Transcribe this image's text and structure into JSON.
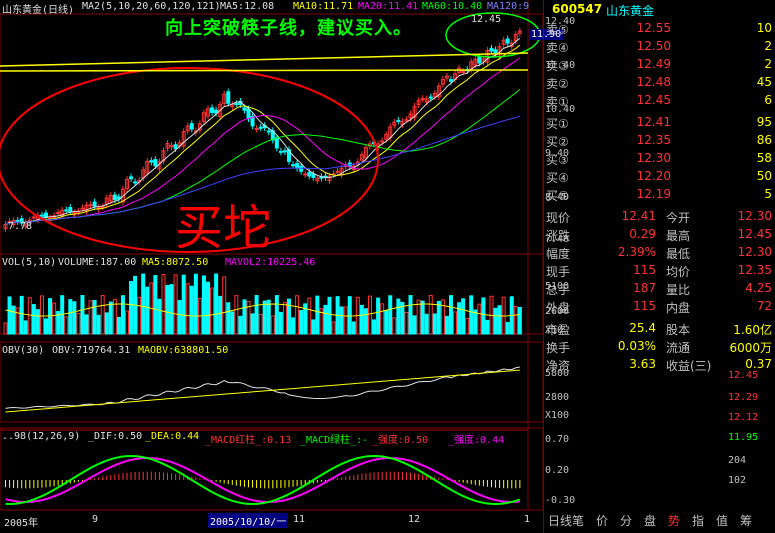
{
  "stock": {
    "name": "山东黄金",
    "code": "600547"
  },
  "main": {
    "title": "山东黄金(日线)",
    "ma_header": "MA2(5,10,20,60,120,121)",
    "ma5": "MA5:12.08",
    "ma10": "MA10:11.71",
    "ma20": "MA20:11.41",
    "ma60": "MA60:10.40",
    "ma120": "MA120:9",
    "annotation": "向上突破筷子线，建议买入。",
    "big_label": "买坨",
    "high_mark": "12.45",
    "low_mark": "7.78",
    "current_price": "11.90",
    "y_ticks": [
      "12.40",
      "11.40",
      "10.40",
      "9.40",
      "8.40",
      "7.40"
    ]
  },
  "volume": {
    "header": "VOL(5,10)",
    "vol": "VOLUME:187.00",
    "ma5": "MA5:8072.50",
    "ma10": "MAVOL2:10225.46",
    "y_ticks": [
      "5100",
      "2600"
    ],
    "multiplier": "X10"
  },
  "obv": {
    "header": "OBV(30)",
    "obv": "OBV:719764.31",
    "maobv": "MAOBV:638801.50",
    "y_ticks": [
      "5800",
      "2800"
    ],
    "multiplier": "X100"
  },
  "macd": {
    "header": "..98(12,26,9)",
    "dif": "_DIF:0.50",
    "dea": "_DEA:0.44",
    "red": "_MACD红柱_:0.13",
    "green": "_MACD绿柱_:-",
    "strength1": "_强度:0.50",
    "strength2": "_强度:0.44",
    "y_ticks": [
      "0.70",
      "0.20",
      "-0.30"
    ]
  },
  "x_axis": {
    "labels": [
      "2005年",
      "9",
      "2005/10/10/一",
      "11",
      "12",
      "1"
    ]
  },
  "quotes": {
    "sells": [
      {
        "label": "卖⑤",
        "price": "12.55",
        "vol": "10"
      },
      {
        "label": "卖④",
        "price": "12.50",
        "vol": "2"
      },
      {
        "label": "卖③",
        "price": "12.49",
        "vol": "2"
      },
      {
        "label": "卖②",
        "price": "12.48",
        "vol": "45"
      },
      {
        "label": "卖①",
        "price": "12.45",
        "vol": "6"
      }
    ],
    "buys": [
      {
        "label": "买①",
        "price": "12.41",
        "vol": "95"
      },
      {
        "label": "买②",
        "price": "12.35",
        "vol": "86"
      },
      {
        "label": "买③",
        "price": "12.30",
        "vol": "58"
      },
      {
        "label": "买④",
        "price": "12.20",
        "vol": "50"
      },
      {
        "label": "买⑤",
        "price": "12.19",
        "vol": "5"
      }
    ]
  },
  "stats": [
    {
      "l1": "现价",
      "v1": "12.41",
      "l2": "今开",
      "v2": "12.30"
    },
    {
      "l1": "涨跌",
      "v1": "0.29",
      "l2": "最高",
      "v2": "12.45"
    },
    {
      "l1": "幅度",
      "v1": "2.39%",
      "l2": "最低",
      "v2": "12.30"
    },
    {
      "l1": "现手",
      "v1": "115",
      "l2": "均价",
      "v2": "12.35"
    },
    {
      "l1": "总手",
      "v1": "187",
      "l2": "量比",
      "v2": "4.25"
    },
    {
      "l1": "外盘",
      "v1": "115",
      "l2": "内盘",
      "v2": "72"
    }
  ],
  "fund": [
    {
      "l1": "市盈",
      "v1": "25.4",
      "l2": "股本",
      "v2": "1.60亿"
    },
    {
      "l1": "换手",
      "v1": "0.03%",
      "l2": "流通",
      "v2": "6000万"
    },
    {
      "l1": "净资",
      "v1": "3.63",
      "l2": "收益(三)",
      "v2": "0.37"
    }
  ],
  "mini_chart": {
    "ticks": [
      "12.45",
      "12.29",
      "12.12",
      "11.95",
      "204",
      "102"
    ]
  },
  "tabs": [
    "日线",
    "笔",
    "价",
    "分",
    "盘",
    "势",
    "指",
    "值",
    "筹"
  ],
  "colors": {
    "up": "#ff3333",
    "down": "#00ffff",
    "grid": "#800000",
    "accent": "#ffff00"
  }
}
